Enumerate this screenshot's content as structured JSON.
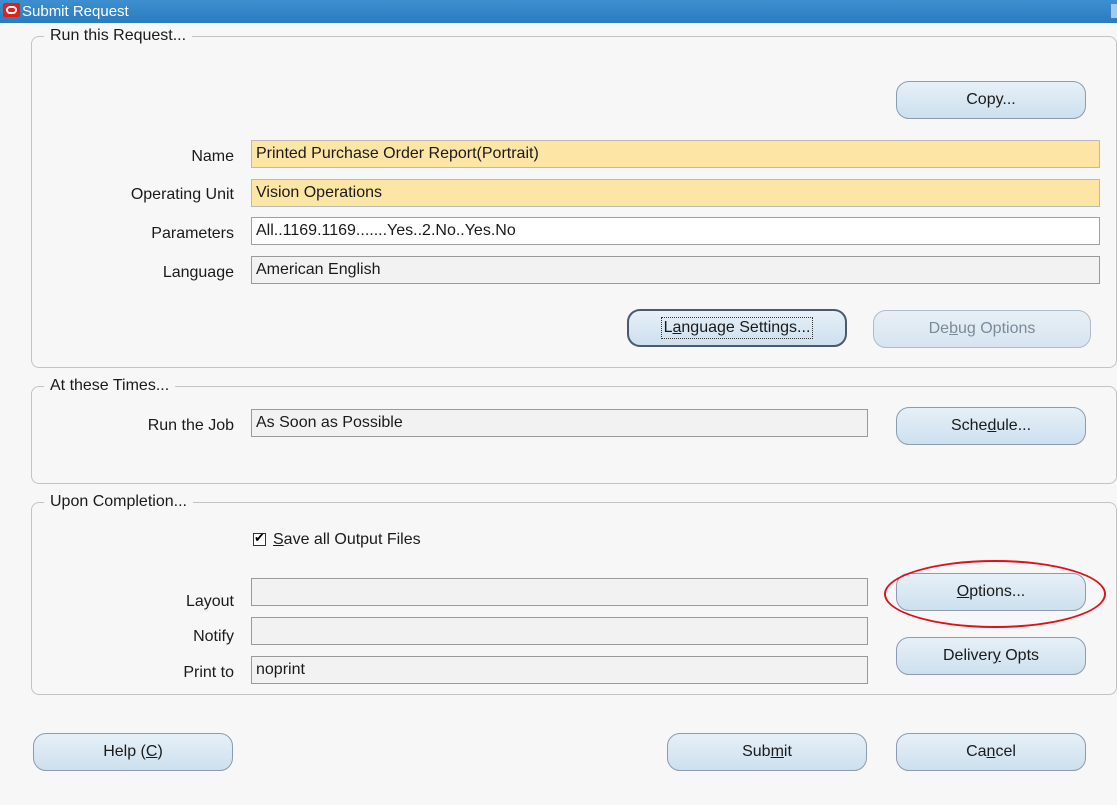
{
  "window": {
    "title": "Submit Request"
  },
  "run_request": {
    "legend": "Run this Request...",
    "copy_button": "Copy...",
    "name_label": "Name",
    "name_value": "Printed Purchase Order Report(Portrait)",
    "operating_unit_label": "Operating Unit",
    "operating_unit_value": "Vision Operations",
    "parameters_label": "Parameters",
    "parameters_value": "All..1169.1169.......Yes..2.No..Yes.No",
    "language_label": "Language",
    "language_value": "American English",
    "language_settings_pre": "L",
    "language_settings_mn": "a",
    "language_settings_post": "nguage Settings...",
    "debug_pre": "De",
    "debug_mn": "b",
    "debug_post": "ug Options"
  },
  "times": {
    "legend": "At these Times...",
    "run_job_label": "Run the Job",
    "run_job_value": "As Soon as Possible",
    "schedule_pre": "Sche",
    "schedule_mn": "d",
    "schedule_post": "ule..."
  },
  "completion": {
    "legend": "Upon Completion...",
    "save_output_mn": "S",
    "save_output_post": "ave all Output Files",
    "save_output_checked": true,
    "layout_label": "Layout",
    "layout_value": "",
    "notify_label": "Notify",
    "notify_value": "",
    "print_to_label": "Print to",
    "print_to_value": "noprint",
    "options_mn": "O",
    "options_post": "ptions...",
    "delivery_pre": "Deliver",
    "delivery_mn": "y",
    "delivery_post": " Opts"
  },
  "footer": {
    "help_pre": "Help (",
    "help_mn": "C",
    "help_post": ")",
    "submit_pre": "Sub",
    "submit_mn": "m",
    "submit_post": "it",
    "cancel_pre": "Ca",
    "cancel_mn": "n",
    "cancel_post": "cel"
  },
  "colors": {
    "title_bar": "#2a7cc0",
    "required_field": "#fde6a5",
    "annotation": "#e0101a"
  }
}
